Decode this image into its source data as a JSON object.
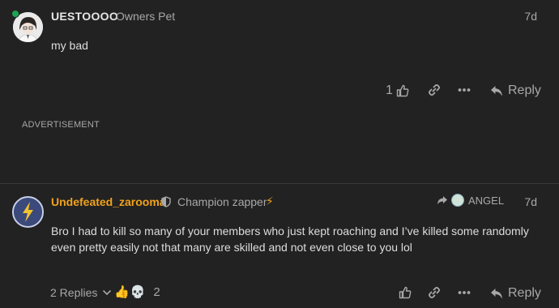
{
  "post1": {
    "username": "UESTOOOO",
    "user_title": "Owners Pet",
    "date": "7d",
    "body": "my bad",
    "like_count": "1",
    "reply_label": "Reply"
  },
  "advertisement": {
    "label": "ADVERTISEMENT"
  },
  "post2": {
    "username": "Undefeated_zarooma",
    "user_title": "Champion zapper",
    "title_emoji": "⚡",
    "reply_to_user": "ANGEL",
    "date": "7d",
    "body": "Bro I had to kill so many of your members who just kept roaching and I’ve killed some randomly even pretty easily not that many are skilled and not even close to you lol",
    "replies_label": "2 Replies",
    "reactions": [
      "👍",
      "💀"
    ],
    "reaction_count": "2",
    "reply_label": "Reply"
  },
  "colors": {
    "background": "#222222",
    "username_highlight": "#f0a31c",
    "online": "#1ca551",
    "muted": "#a8a8a8"
  }
}
